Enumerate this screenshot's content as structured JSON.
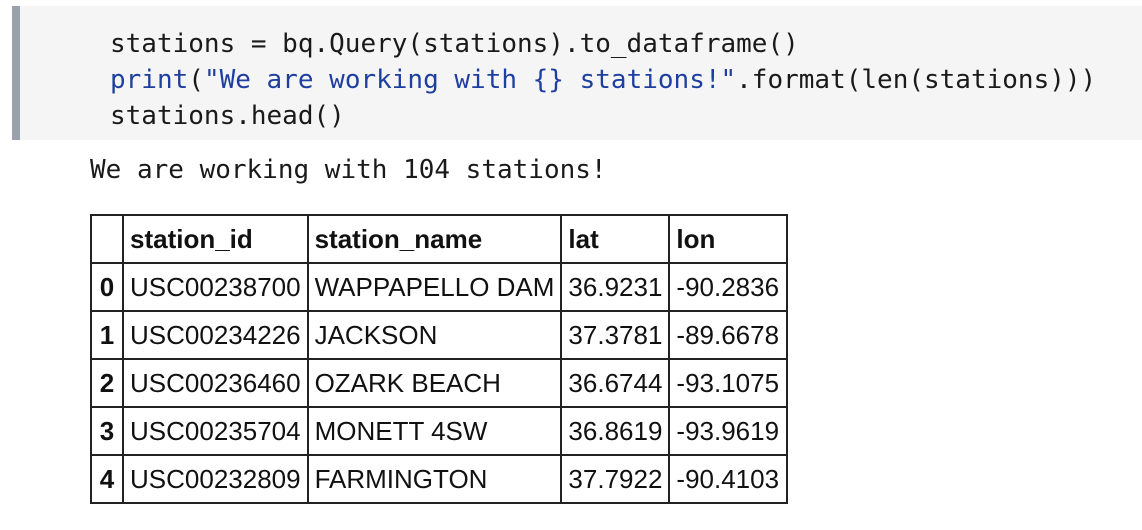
{
  "code": {
    "line1": "stations = bq.Query(stations).to_dataframe()",
    "line2_builtin": "print",
    "line2_open": "(",
    "line2_string": "\"We are working with {} stations!\"",
    "line2_rest": ".format(len(stations)))",
    "line3": "stations.head()"
  },
  "output": {
    "stdout": "We are working with 104 stations!"
  },
  "table": {
    "columns": [
      "",
      "station_id",
      "station_name",
      "lat",
      "lon"
    ],
    "rows": [
      {
        "index": "0",
        "station_id": "USC00238700",
        "station_name": "WAPPAPELLO DAM",
        "lat": "36.9231",
        "lon": "-90.2836"
      },
      {
        "index": "1",
        "station_id": "USC00234226",
        "station_name": "JACKSON",
        "lat": "37.3781",
        "lon": "-89.6678"
      },
      {
        "index": "2",
        "station_id": "USC00236460",
        "station_name": "OZARK BEACH",
        "lat": "36.6744",
        "lon": "-93.1075"
      },
      {
        "index": "3",
        "station_id": "USC00235704",
        "station_name": "MONETT 4SW",
        "lat": "36.8619",
        "lon": "-93.9619"
      },
      {
        "index": "4",
        "station_id": "USC00232809",
        "station_name": "FARMINGTON",
        "lat": "37.7922",
        "lon": "-90.4103"
      }
    ]
  },
  "colors": {
    "input_background": "#f5f5f5",
    "input_border": "#9aa1aa",
    "keyword": "#1f3fa0"
  }
}
